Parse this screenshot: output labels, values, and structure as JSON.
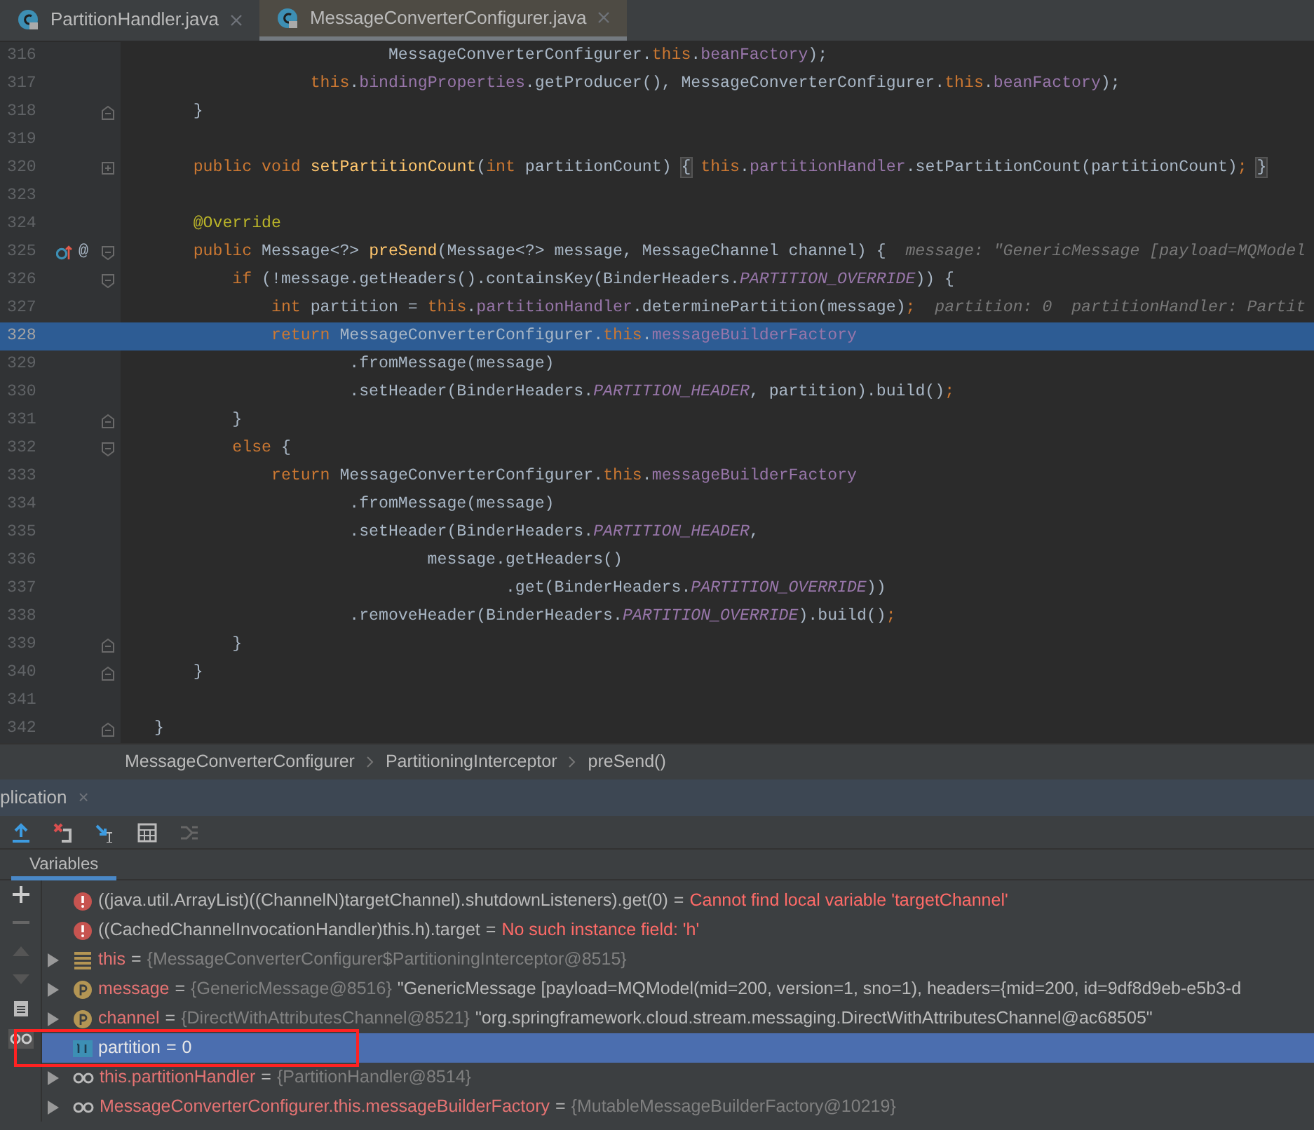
{
  "editor_tabs": [
    {
      "label": "PartitionHandler.java",
      "selected": false
    },
    {
      "label": "MessageConverterConfigurer.java",
      "selected": true
    }
  ],
  "code_lines": [
    {
      "number": "316",
      "tokens": [
        {
          "kind": "t",
          "text": "                        MessageConverterConfigurer."
        },
        {
          "kind": "k",
          "text": "this"
        },
        {
          "kind": "t",
          "text": "."
        },
        {
          "kind": "f",
          "text": "beanFactory"
        },
        {
          "kind": "t",
          "text": ");"
        }
      ]
    },
    {
      "number": "317",
      "tokens": [
        {
          "kind": "k",
          "text": "                this"
        },
        {
          "kind": "t",
          "text": "."
        },
        {
          "kind": "f",
          "text": "bindingProperties"
        },
        {
          "kind": "t",
          "text": ".getProducer(), MessageConverterConfigurer."
        },
        {
          "kind": "k",
          "text": "this"
        },
        {
          "kind": "t",
          "text": "."
        },
        {
          "kind": "f",
          "text": "beanFactory"
        },
        {
          "kind": "t",
          "text": ");"
        }
      ]
    },
    {
      "number": "318",
      "fold_end": true,
      "tokens": [
        {
          "kind": "t",
          "text": "    }"
        }
      ]
    },
    {
      "number": "319"
    },
    {
      "number": "320",
      "collapsed": true,
      "tokens": [
        {
          "kind": "k",
          "text": "    public void "
        },
        {
          "kind": "m",
          "text": "setPartitionCount"
        },
        {
          "kind": "t",
          "text": "("
        },
        {
          "kind": "k",
          "text": "int "
        },
        {
          "kind": "t",
          "text": "partitionCount) "
        },
        {
          "kind": "p",
          "text": "{"
        },
        {
          "kind": "k",
          "text": " this"
        },
        {
          "kind": "t",
          "text": "."
        },
        {
          "kind": "f",
          "text": "partitionHandler"
        },
        {
          "kind": "t",
          "text": ".setPartitionCount(partitionCount)"
        },
        {
          "kind": "k",
          "text": "; "
        },
        {
          "kind": "p",
          "text": "}"
        }
      ]
    },
    {
      "number": "323"
    },
    {
      "number": "324",
      "tokens": [
        {
          "kind": "a",
          "text": "    @Override"
        }
      ]
    },
    {
      "number": "325",
      "fold_start": true,
      "gutter_marker": "@",
      "tokens": [
        {
          "kind": "k",
          "text": "    public "
        },
        {
          "kind": "t",
          "text": "Message<?> "
        },
        {
          "kind": "m",
          "text": "preSend"
        },
        {
          "kind": "t",
          "text": "(Message<?> message, MessageChannel channel) {"
        },
        {
          "kind": "h",
          "text": "  message: \"GenericMessage [payload=MQModel"
        }
      ]
    },
    {
      "number": "326",
      "fold_start": true,
      "tokens": [
        {
          "kind": "k",
          "text": "        if "
        },
        {
          "kind": "t",
          "text": "(!message.getHeaders().containsKey(BinderHeaders."
        },
        {
          "kind": "c",
          "text": "PARTITION_OVERRIDE"
        },
        {
          "kind": "t",
          "text": ")) {"
        }
      ]
    },
    {
      "number": "327",
      "tokens": [
        {
          "kind": "k",
          "text": "            int "
        },
        {
          "kind": "t",
          "text": "partition = "
        },
        {
          "kind": "k",
          "text": "this"
        },
        {
          "kind": "t",
          "text": "."
        },
        {
          "kind": "f",
          "text": "partitionHandler"
        },
        {
          "kind": "t",
          "text": ".determinePartition(message)"
        },
        {
          "kind": "k",
          "text": ";"
        },
        {
          "kind": "h",
          "text": "  partition: 0  partitionHandler: Partit"
        }
      ]
    },
    {
      "number": "328",
      "current": true,
      "tokens": [
        {
          "kind": "k",
          "text": "            return "
        },
        {
          "kind": "t",
          "text": "MessageConverterConfigurer."
        },
        {
          "kind": "k",
          "text": "this"
        },
        {
          "kind": "t",
          "text": "."
        },
        {
          "kind": "f",
          "text": "messageBuilderFactory"
        }
      ]
    },
    {
      "number": "329",
      "tokens": [
        {
          "kind": "t",
          "text": "                    .fromMessage(message)"
        }
      ]
    },
    {
      "number": "330",
      "tokens": [
        {
          "kind": "t",
          "text": "                    .setHeader(BinderHeaders."
        },
        {
          "kind": "c",
          "text": "PARTITION_HEADER"
        },
        {
          "kind": "t",
          "text": ", partition).build()"
        },
        {
          "kind": "k",
          "text": ";"
        }
      ]
    },
    {
      "number": "331",
      "fold_end": true,
      "tokens": [
        {
          "kind": "t",
          "text": "        }"
        }
      ]
    },
    {
      "number": "332",
      "fold_start": true,
      "tokens": [
        {
          "kind": "k",
          "text": "        else "
        },
        {
          "kind": "t",
          "text": "{"
        }
      ]
    },
    {
      "number": "333",
      "tokens": [
        {
          "kind": "k",
          "text": "            return "
        },
        {
          "kind": "t",
          "text": "MessageConverterConfigurer."
        },
        {
          "kind": "k",
          "text": "this"
        },
        {
          "kind": "t",
          "text": "."
        },
        {
          "kind": "f",
          "text": "messageBuilderFactory"
        }
      ]
    },
    {
      "number": "334",
      "tokens": [
        {
          "kind": "t",
          "text": "                    .fromMessage(message)"
        }
      ]
    },
    {
      "number": "335",
      "tokens": [
        {
          "kind": "t",
          "text": "                    .setHeader(BinderHeaders."
        },
        {
          "kind": "c",
          "text": "PARTITION_HEADER"
        },
        {
          "kind": "t",
          "text": ","
        }
      ]
    },
    {
      "number": "336",
      "tokens": [
        {
          "kind": "t",
          "text": "                            message.getHeaders()"
        }
      ]
    },
    {
      "number": "337",
      "tokens": [
        {
          "kind": "t",
          "text": "                                    .get(BinderHeaders."
        },
        {
          "kind": "c",
          "text": "PARTITION_OVERRIDE"
        },
        {
          "kind": "t",
          "text": "))"
        }
      ]
    },
    {
      "number": "338",
      "tokens": [
        {
          "kind": "t",
          "text": "                    .removeHeader(BinderHeaders."
        },
        {
          "kind": "c",
          "text": "PARTITION_OVERRIDE"
        },
        {
          "kind": "t",
          "text": ").build()"
        },
        {
          "kind": "k",
          "text": ";"
        }
      ]
    },
    {
      "number": "339",
      "fold_end": true,
      "tokens": [
        {
          "kind": "t",
          "text": "        }"
        }
      ]
    },
    {
      "number": "340",
      "fold_end": true,
      "tokens": [
        {
          "kind": "t",
          "text": "    }"
        }
      ]
    },
    {
      "number": "341"
    },
    {
      "number": "342",
      "fold_end": true,
      "tokens": [
        {
          "kind": "t",
          "text": "}"
        }
      ]
    }
  ],
  "breadcrumbs": [
    "MessageConverterConfigurer",
    "PartitioningInterceptor",
    "preSend()"
  ],
  "debug_tab": {
    "label": "plication",
    "close": "×"
  },
  "panel_tabs": [
    {
      "label": "Variables",
      "selected": true
    }
  ],
  "variables": [
    {
      "kind": "error",
      "expandable": false,
      "selected": false,
      "name": "((java.util.ArrayList)((ChannelN)targetChannel).shutdownListeners).get(0)",
      "operator": "=",
      "value": "Cannot find local variable 'targetChannel'"
    },
    {
      "kind": "error",
      "expandable": false,
      "selected": false,
      "name": "((CachedChannelInvocationHandler)this.h).target",
      "operator": "=",
      "value": "No such instance field: 'h'"
    },
    {
      "kind": "object",
      "expandable": true,
      "selected": false,
      "name": "this",
      "operator": "=",
      "ref": "{MessageConverterConfigurer$PartitioningInterceptor@8515}"
    },
    {
      "kind": "param",
      "expandable": true,
      "selected": false,
      "name": "message",
      "operator": "=",
      "ref": "{GenericMessage@8516}",
      "value": "\"GenericMessage [payload=MQModel(mid=200, version=1, sno=1), headers={mid=200, id=9df8d9eb-e5b3-d"
    },
    {
      "kind": "param",
      "expandable": true,
      "selected": false,
      "name": "channel",
      "operator": "=",
      "ref": "{DirectWithAttributesChannel@8521}",
      "value": "\"org.springframework.cloud.stream.messaging.DirectWithAttributesChannel@ac68505\""
    },
    {
      "kind": "primitive",
      "expandable": false,
      "selected": true,
      "boxed": true,
      "name": "partition",
      "operator": "=",
      "value": "0"
    },
    {
      "kind": "watch",
      "expandable": true,
      "selected": false,
      "name": "this.partitionHandler",
      "operator": "=",
      "ref": "{PartitionHandler@8514}"
    },
    {
      "kind": "watch",
      "expandable": true,
      "selected": false,
      "name": "MessageConverterConfigurer.this.messageBuilderFactory",
      "operator": "=",
      "ref": "{MutableMessageBuilderFactory@10219}"
    }
  ]
}
